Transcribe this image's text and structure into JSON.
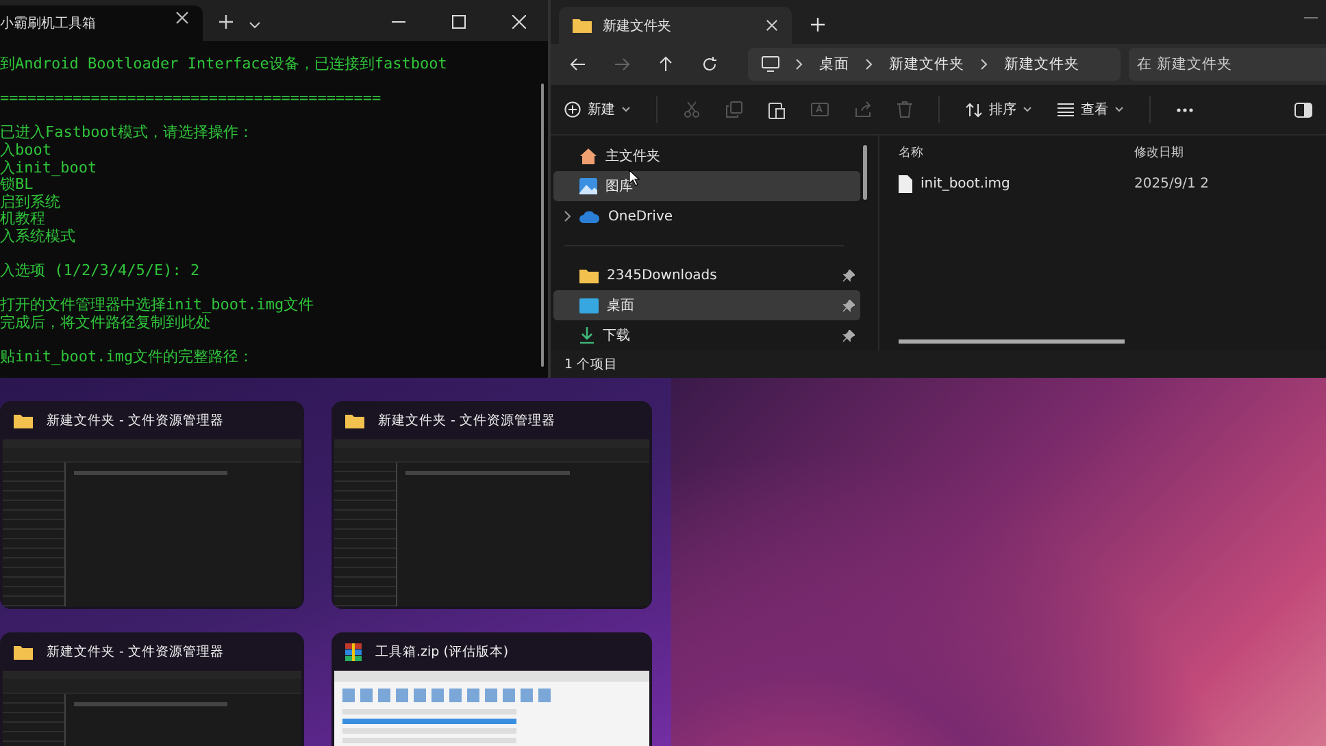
{
  "terminal": {
    "tab_title": "小霸刷机工具箱",
    "paragraphs": [
      [
        "到Android Bootloader Interface设备，已连接到fastboot"
      ],
      [
        "=========================================="
      ],
      [
        "已进入Fastboot模式，请选择操作：",
        "入boot",
        "入init_boot",
        "锁BL",
        "启到系统",
        "机教程",
        "入系统模式"
      ],
      [
        "入选项 (1/2/3/4/5/E): 2"
      ],
      [
        "打开的文件管理器中选择init_boot.img文件",
        "完成后，将文件路径复制到此处"
      ],
      [
        "贴init_boot.img文件的完整路径："
      ]
    ]
  },
  "explorer": {
    "tab_title": "新建文件夹",
    "breadcrumb": [
      "桌面",
      "新建文件夹",
      "新建文件夹"
    ],
    "search": {
      "placeholder": "在 新建文件夹"
    },
    "toolbar": {
      "new_label": "新建",
      "sort_label": "排序",
      "view_label": "查看"
    },
    "nav_items": [
      {
        "kind": "home",
        "label": "主文件夹",
        "selected": false,
        "pinned": false,
        "expandable": false
      },
      {
        "kind": "gallery",
        "label": "图库",
        "selected": true,
        "pinned": false,
        "expandable": false
      },
      {
        "kind": "cloud",
        "label": "OneDrive",
        "selected": false,
        "pinned": false,
        "expandable": true
      },
      {
        "kind": "divider"
      },
      {
        "kind": "folder",
        "label": "2345Downloads",
        "selected": false,
        "pinned": true,
        "expandable": false
      },
      {
        "kind": "desktop",
        "label": "桌面",
        "selected": true,
        "pinned": true,
        "expandable": false
      },
      {
        "kind": "download",
        "label": "下载",
        "selected": false,
        "pinned": true,
        "expandable": false
      }
    ],
    "columns": [
      "名称",
      "修改日期"
    ],
    "files": [
      {
        "name": "init_boot.img",
        "modified": "2025/9/1 2"
      }
    ],
    "status": "1 个项目"
  },
  "snap_assist": {
    "windows": [
      {
        "kind": "explorer",
        "title": "新建文件夹 - 文件资源管理器"
      },
      {
        "kind": "explorer",
        "title": "新建文件夹 - 文件资源管理器"
      },
      {
        "kind": "explorer",
        "title": "新建文件夹 - 文件资源管理器"
      },
      {
        "kind": "archive",
        "title": "工具箱.zip (评估版本)"
      }
    ]
  }
}
